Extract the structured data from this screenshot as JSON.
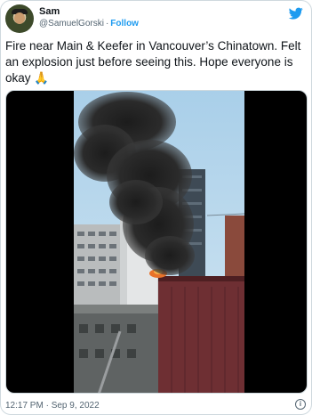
{
  "tweet": {
    "author_name": "Sam",
    "handle": "@SamuelGorski",
    "separator": "·",
    "follow_label": "Follow",
    "text": "Fire near Main & Keefer in Vancouver’s Chinatown. Felt an explosion just before seeing this. Hope everyone is okay 🙏",
    "timestamp": "12:17 PM · Sep 9, 2022",
    "info_symbol": "i"
  },
  "colors": {
    "brand": "#1d9bf0",
    "muted": "#536471",
    "text": "#0f1419"
  },
  "icons": {
    "logo": "twitter-bird-icon",
    "info": "info-icon"
  }
}
